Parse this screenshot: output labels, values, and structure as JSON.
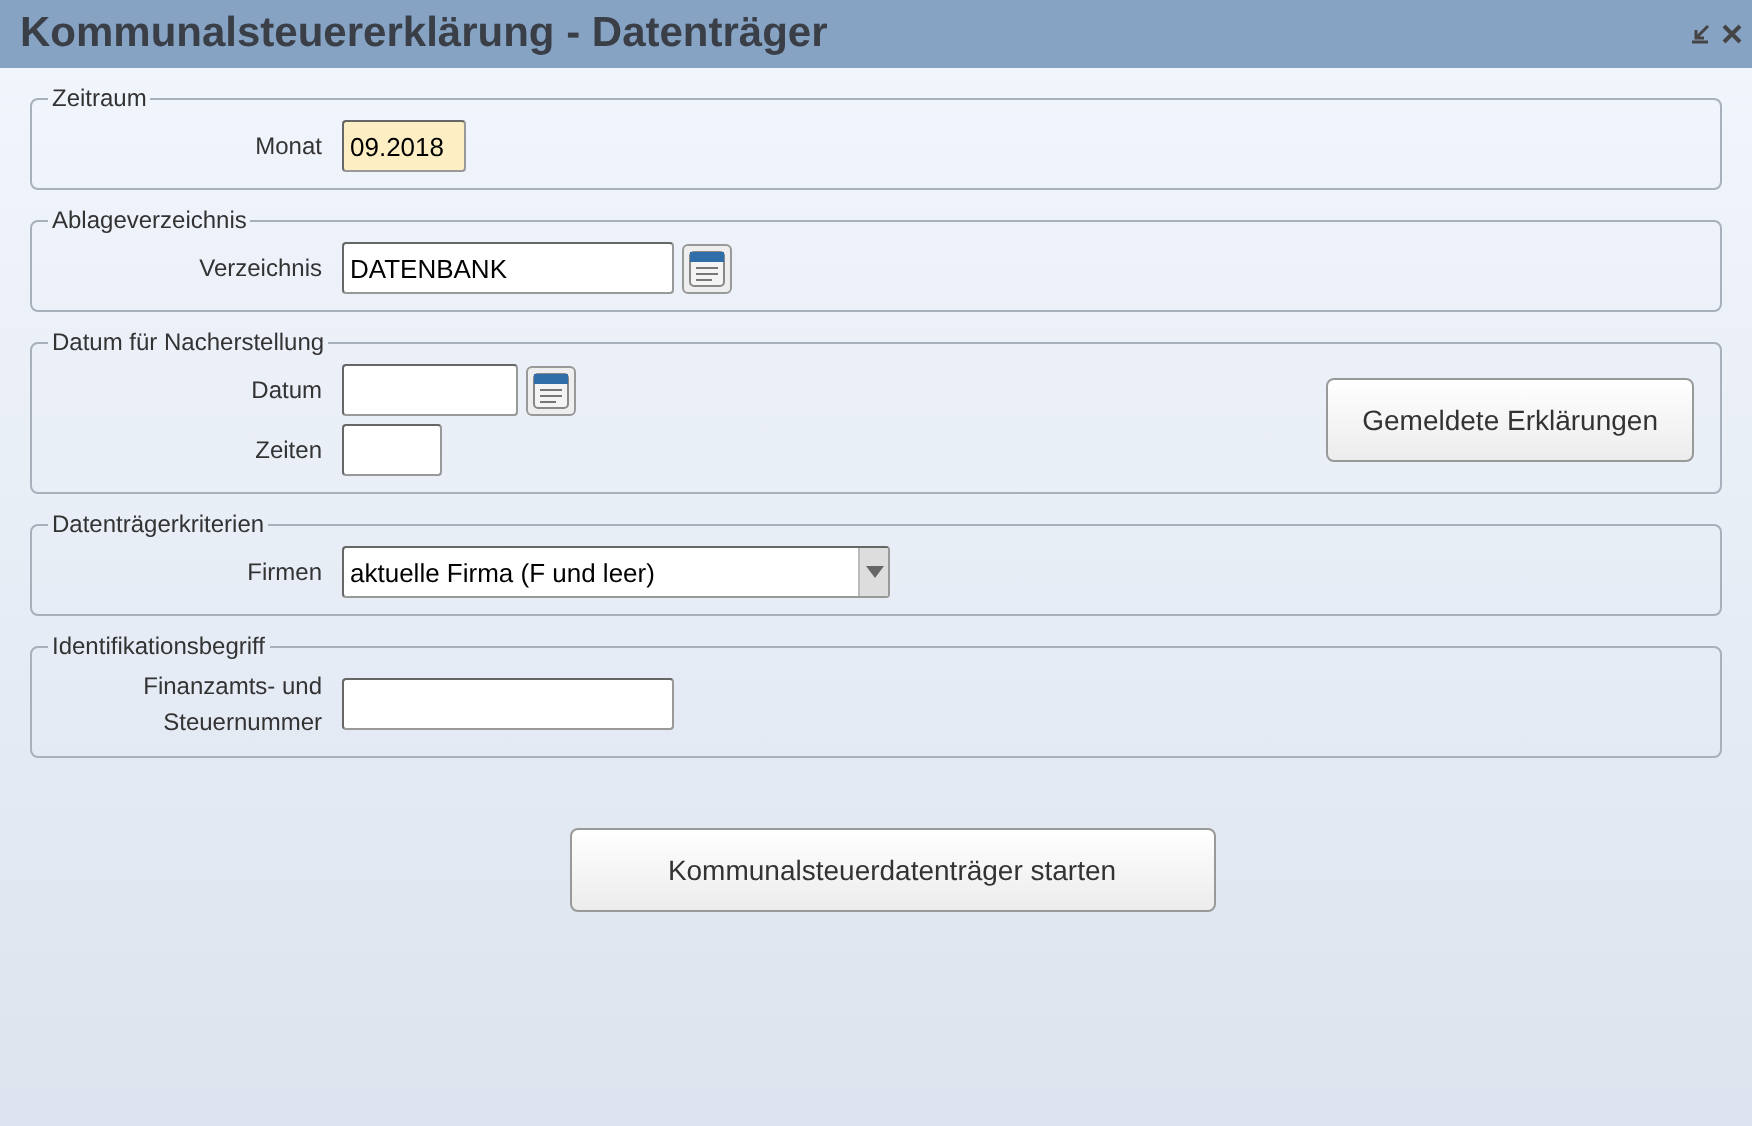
{
  "window": {
    "title": "Kommunalsteuererklärung - Datenträger"
  },
  "sections": [
    {
      "legend": "Zeitraum",
      "fields": [
        {
          "label": "Monat",
          "kind": "text",
          "value": "09.2018",
          "focused": true
        }
      ]
    },
    {
      "legend": "Ablageverzeichnis",
      "fields": [
        {
          "label": "Verzeichnis",
          "kind": "picker",
          "value": "DATENBANK",
          "focused": false
        }
      ]
    },
    {
      "legend": "Datum für Nacherstellung",
      "fields": [
        {
          "label": "Datum",
          "kind": "picker",
          "focused": false
        },
        {
          "label": "Zeiten",
          "kind": "text",
          "focused": false
        }
      ],
      "button": "Gemeldete Erklärungen"
    },
    {
      "legend": "Datenträgerkriterien",
      "fields": [
        {
          "label": "Firmen",
          "kind": "select",
          "value": "aktuelle Firma (F und leer)",
          "focused": false
        }
      ]
    },
    {
      "legend": "Identifikationsbegriff",
      "fields": [
        {
          "label": "Finanzamts- und Steuernummer",
          "kind": "text",
          "focused": false
        }
      ]
    }
  ],
  "start_button": "Kommunalsteuerdatenträger starten"
}
